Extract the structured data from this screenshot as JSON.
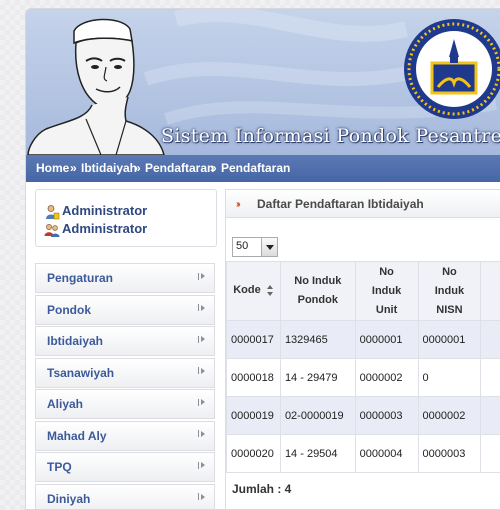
{
  "header": {
    "site_title": "Sistem Informasi Pondok Pesantren A",
    "breadcrumb": {
      "items": [
        "Home",
        "Ibtidaiyah",
        "Pendaftaran",
        "Pendaftaran"
      ],
      "separator": "»"
    }
  },
  "user_box": {
    "rows": [
      {
        "label": "Administrator",
        "icon": "user-icon"
      },
      {
        "label": "Administrator",
        "icon": "users-icon"
      }
    ]
  },
  "sidebar": {
    "items": [
      {
        "label": "Pengaturan"
      },
      {
        "label": "Pondok"
      },
      {
        "label": "Ibtidaiyah"
      },
      {
        "label": "Tsanawiyah"
      },
      {
        "label": "Aliyah"
      },
      {
        "label": "Mahad Aly"
      },
      {
        "label": "TPQ"
      },
      {
        "label": "Diniyah"
      }
    ]
  },
  "panel": {
    "title": "Daftar Pendaftaran Ibtidaiyah",
    "page_size": "50",
    "table": {
      "columns": [
        {
          "line1": "Kode",
          "line2": "",
          "line3": ""
        },
        {
          "line1": "No Induk",
          "line2": "Pondok",
          "line3": ""
        },
        {
          "line1": "No",
          "line2": "Induk",
          "line3": "Unit"
        },
        {
          "line1": "No",
          "line2": "Induk",
          "line3": "NISN"
        }
      ],
      "rows": [
        [
          "0000017",
          "1329465",
          "0000001",
          "0000001"
        ],
        [
          "0000018",
          "14 - 29479",
          "0000002",
          "0"
        ],
        [
          "0000019",
          "02-0000019",
          "0000003",
          "0000002"
        ],
        [
          "0000020",
          "14 - 29504",
          "0000004",
          "0000003"
        ]
      ]
    },
    "total": "Jumlah : 4"
  },
  "colors": {
    "brand_blue": "#4566a6",
    "banner_blue": "#b4c5e3",
    "link_blue": "#3c5a99",
    "row_highlight": "#e9ebf6",
    "accent_orange": "#d24b1e"
  }
}
